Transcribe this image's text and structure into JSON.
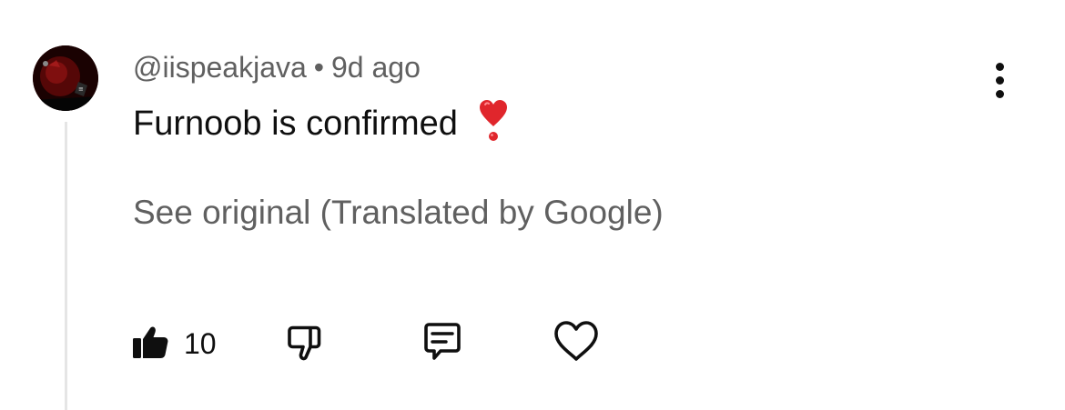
{
  "comment": {
    "author": "@iispeakjava",
    "separator": "•",
    "time_ago": "9d ago",
    "text": "Furnoob is confirmed",
    "emoji": "heavy-exclamation-mark-heart",
    "translation_link": "See original (Translated by Google)"
  },
  "actions": {
    "like_icon": "thumbs-up-filled-icon",
    "like_count": "10",
    "dislike_icon": "thumbs-down-icon",
    "reply_icon": "comment-icon",
    "heart_icon": "heart-outline-icon"
  },
  "menu": {
    "icon": "more-vertical-icon"
  },
  "colors": {
    "primary_text": "#0f0f0f",
    "secondary_text": "#606060",
    "thread_line": "#e5e5e5",
    "emoji_red": "#e0262c"
  }
}
